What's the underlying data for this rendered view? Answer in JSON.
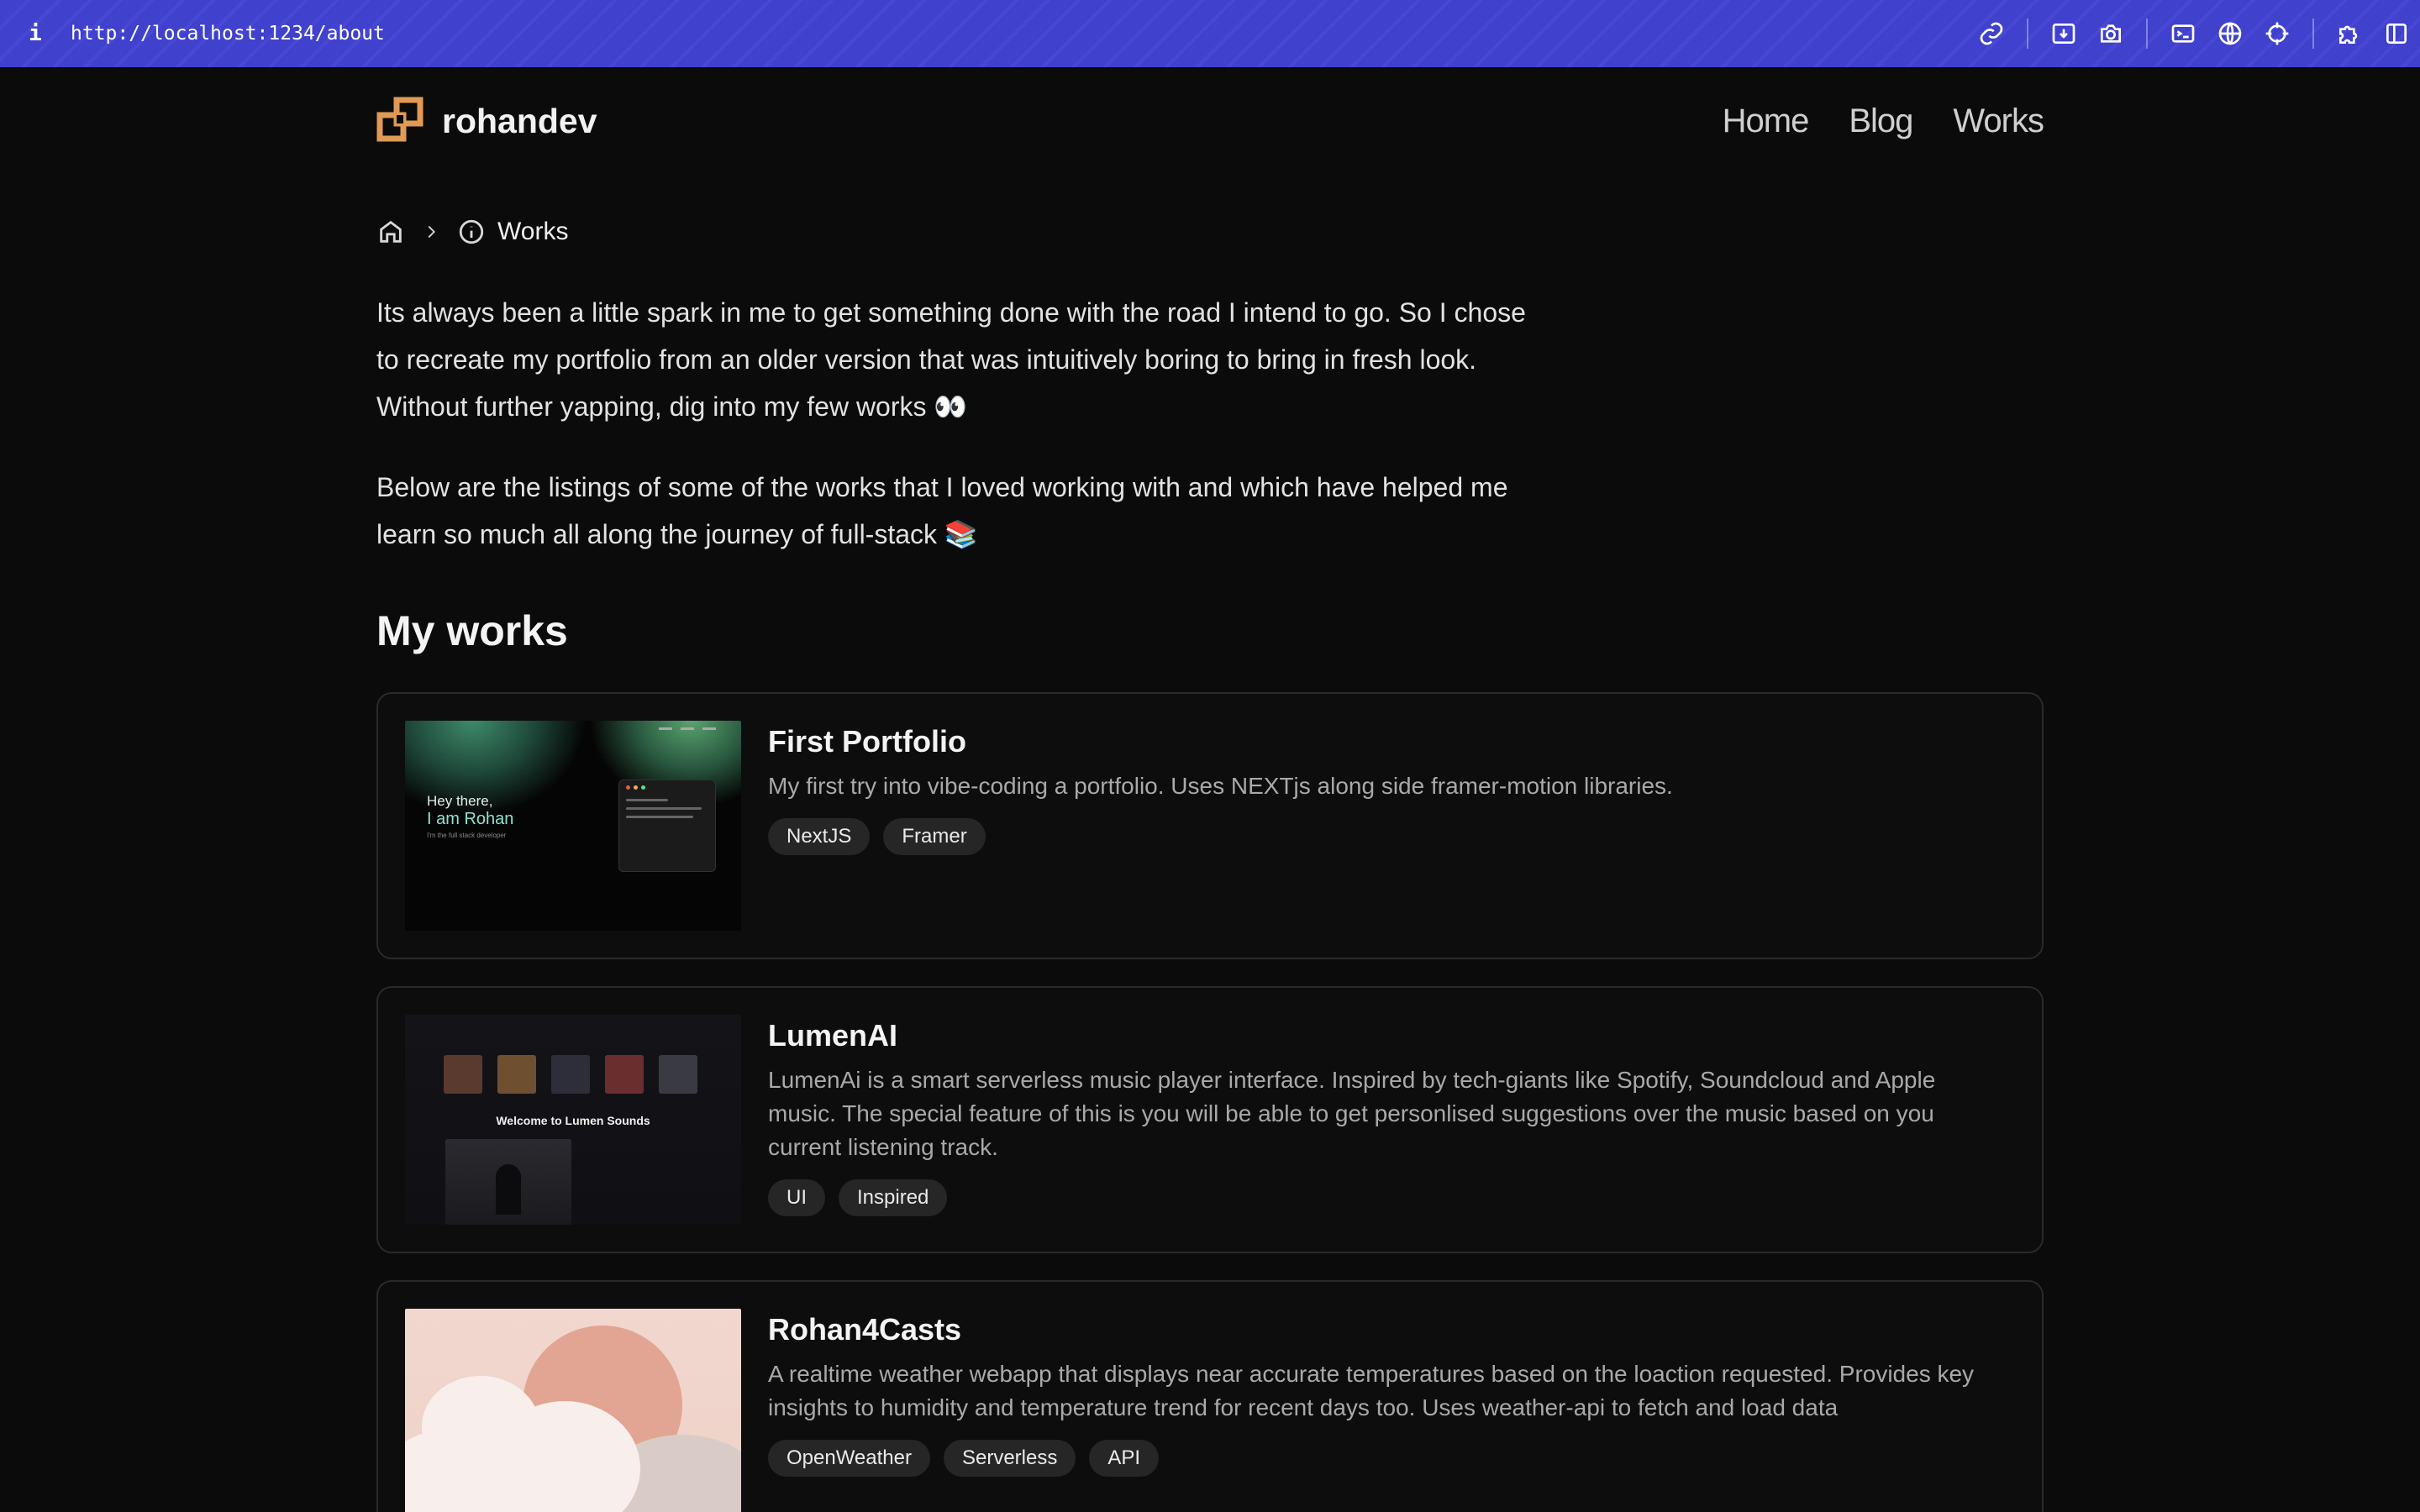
{
  "browser": {
    "info_icon": "i",
    "url": "http://localhost:1234/about",
    "tools": [
      "link-icon",
      "download-icon",
      "camera-icon",
      "terminal-icon",
      "globe-icon",
      "crosshair-icon",
      "extension-icon",
      "sidebar-icon"
    ]
  },
  "header": {
    "brand_name": "rohandev",
    "nav": [
      {
        "label": "Home"
      },
      {
        "label": "Blog"
      },
      {
        "label": "Works"
      }
    ]
  },
  "breadcrumb": {
    "current": "Works"
  },
  "intro": {
    "p1": "Its always been a little spark in me to get something done with the road I intend to go. So I chose to recreate my portfolio from an older version that was intuitively boring to bring in fresh look. Without further yapping, dig into my few works 👀",
    "p2": "Below are the listings of some of the works that I loved working with and which have helped me learn so much all along the journey of full-stack 📚"
  },
  "works": {
    "title": "My works",
    "items": [
      {
        "title": "First Portfolio",
        "description": "My first try into vibe-coding a portfolio. Uses NEXTjs along side framer-motion libraries.",
        "tags": [
          "NextJS",
          "Framer"
        ],
        "thumb": {
          "line1": "Hey there,",
          "line2": "I am Rohan",
          "line3": "I'm the full stack developer"
        }
      },
      {
        "title": "LumenAI",
        "description": "LumenAi is a smart serverless music player interface. Inspired by tech-giants like Spotify, Soundcloud and Apple music. The special feature of this is you will be able to get personlised suggestions over the music based on you current listening track.",
        "tags": [
          "UI",
          "Inspired"
        ],
        "thumb": {
          "welcome": "Welcome to Lumen Sounds"
        }
      },
      {
        "title": "Rohan4Casts",
        "description": "A realtime weather webapp that displays near accurate temperatures based on the loaction requested. Provides key insights to humidity and temperature trend for recent days too. Uses weather-api to fetch and load data",
        "tags": [
          "OpenWeather",
          "Serverless",
          "API"
        ]
      }
    ]
  },
  "colors": {
    "background": "#0b0b0b",
    "browser_bar": "#4041cc",
    "logo": "#e09a55",
    "tag_bg": "#262626"
  }
}
